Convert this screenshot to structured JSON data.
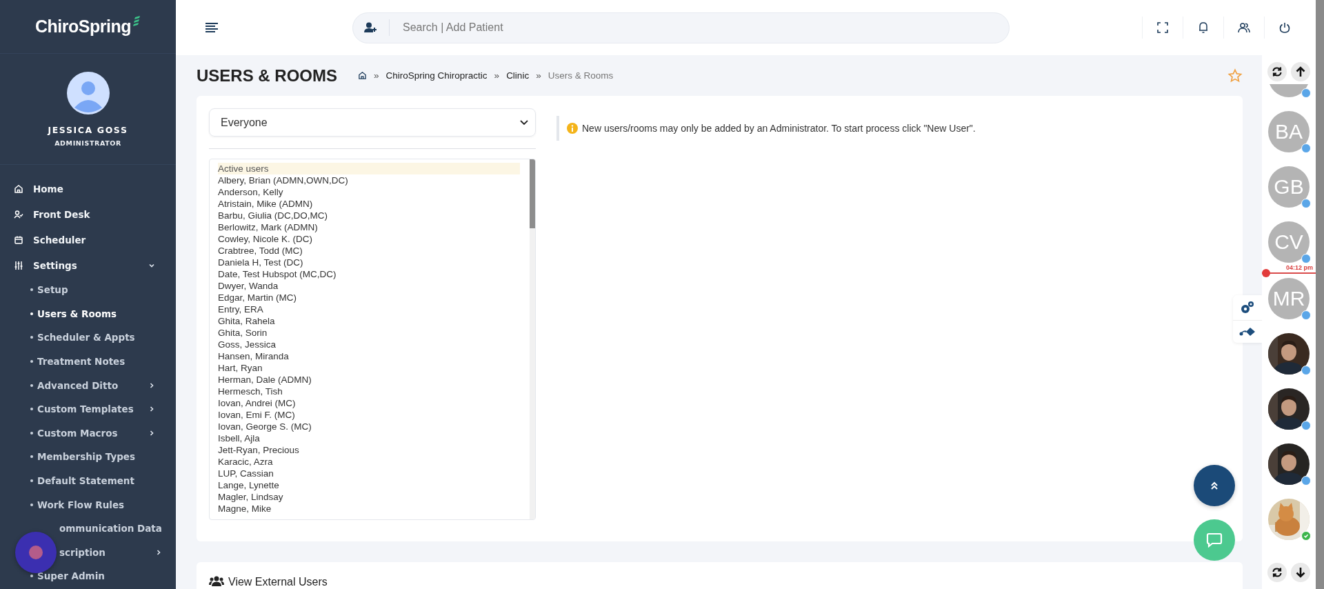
{
  "sidebar": {
    "logo": "ChiroSpring",
    "user": {
      "name": "JESSICA GOSS",
      "role": "ADMINISTRATOR"
    },
    "items": [
      {
        "label": "Home",
        "expanded": false,
        "has_submenu": false
      },
      {
        "label": "Front Desk",
        "expanded": false,
        "has_submenu": false
      },
      {
        "label": "Scheduler",
        "expanded": false,
        "has_submenu": false
      },
      {
        "label": "Settings",
        "expanded": true,
        "has_submenu": true,
        "children": [
          {
            "label": "Setup",
            "selected": false,
            "has_submenu": false,
            "covered": false
          },
          {
            "label": "Users & Rooms",
            "selected": true,
            "has_submenu": false,
            "covered": false
          },
          {
            "label": "Scheduler & Appts",
            "selected": false,
            "has_submenu": false,
            "covered": false
          },
          {
            "label": "Treatment Notes",
            "selected": false,
            "has_submenu": false,
            "covered": false
          },
          {
            "label": "Advanced Ditto",
            "selected": false,
            "has_submenu": true,
            "covered": false
          },
          {
            "label": "Custom Templates",
            "selected": false,
            "has_submenu": true,
            "covered": false
          },
          {
            "label": "Custom Macros",
            "selected": false,
            "has_submenu": true,
            "covered": false
          },
          {
            "label": "Membership Types",
            "selected": false,
            "has_submenu": false,
            "covered": false
          },
          {
            "label": "Default Statement",
            "selected": false,
            "has_submenu": false,
            "covered": false
          },
          {
            "label": "Work Flow Rules",
            "selected": false,
            "has_submenu": false,
            "covered": false
          },
          {
            "label": "ommunication Data",
            "selected": false,
            "has_submenu": false,
            "covered": true
          },
          {
            "label": "scription",
            "selected": false,
            "has_submenu": true,
            "covered": true
          },
          {
            "label": "Super Admin",
            "selected": false,
            "has_submenu": false,
            "covered": false
          }
        ]
      }
    ]
  },
  "topbar": {
    "search": {
      "placeholder": "Search | Add Patient"
    }
  },
  "page": {
    "title": "USERS & ROOMS",
    "breadcrumb": {
      "separator": "»",
      "items": [
        {
          "label": "ChiroSpring Chiropractic",
          "current": false
        },
        {
          "label": "Clinic",
          "current": false
        },
        {
          "label": "Users & Rooms",
          "current": true
        }
      ]
    },
    "favorite": false
  },
  "filter": {
    "value": "Everyone"
  },
  "users": [
    {
      "label": "Active users",
      "selected": true
    },
    {
      "label": "Albery, Brian (ADMN,OWN,DC)",
      "selected": false
    },
    {
      "label": "Anderson, Kelly",
      "selected": false
    },
    {
      "label": "Atristain, Mike (ADMN)",
      "selected": false
    },
    {
      "label": "Barbu, Giulia (DC,DO,MC)",
      "selected": false
    },
    {
      "label": "Berlowitz, Mark (ADMN)",
      "selected": false
    },
    {
      "label": "Cowley, Nicole K. (DC)",
      "selected": false
    },
    {
      "label": "Crabtree, Todd (MC)",
      "selected": false
    },
    {
      "label": "Daniela H, Test (DC)",
      "selected": false
    },
    {
      "label": "Date, Test Hubspot (MC,DC)",
      "selected": false
    },
    {
      "label": "Dwyer, Wanda",
      "selected": false
    },
    {
      "label": "Edgar, Martin (MC)",
      "selected": false
    },
    {
      "label": "Entry, ERA",
      "selected": false
    },
    {
      "label": "Ghita, Rahela",
      "selected": false
    },
    {
      "label": "Ghita, Sorin",
      "selected": false
    },
    {
      "label": "Goss, Jessica",
      "selected": false
    },
    {
      "label": "Hansen, Miranda",
      "selected": false
    },
    {
      "label": "Hart, Ryan",
      "selected": false
    },
    {
      "label": "Herman, Dale (ADMN)",
      "selected": false
    },
    {
      "label": "Hermesch, Tish",
      "selected": false
    },
    {
      "label": "Iovan, Andrei (MC)",
      "selected": false
    },
    {
      "label": "Iovan, Emi F. (MC)",
      "selected": false
    },
    {
      "label": "Iovan, George S. (MC)",
      "selected": false
    },
    {
      "label": "Isbell, Ajla",
      "selected": false
    },
    {
      "label": "Jett-Ryan, Precious",
      "selected": false
    },
    {
      "label": "Karacic, Azra",
      "selected": false
    },
    {
      "label": "LUP, Cassian",
      "selected": false
    },
    {
      "label": "Lange, Lynette",
      "selected": false
    },
    {
      "label": "Magler, Lindsay",
      "selected": false
    },
    {
      "label": "Magne, Mike",
      "selected": false
    }
  ],
  "notice": "New users/rooms may only be added by an Administrator. To start process click \"New User\".",
  "external": {
    "title": "View External Users"
  },
  "rail": {
    "items": [
      {
        "kind": "partial",
        "color": "#5aa6e8",
        "checked": false
      },
      {
        "kind": "initials",
        "initials": "BA",
        "color": "#5aa6e8",
        "checked": false
      },
      {
        "kind": "initials",
        "initials": "GB",
        "color": "#5aa6e8",
        "checked": false
      },
      {
        "kind": "initials",
        "initials": "CV",
        "color": "#5aa6e8",
        "checked": false
      },
      {
        "kind": "now",
        "time": "04:12 pm"
      },
      {
        "kind": "initials",
        "initials": "MR",
        "color": "#5aa6e8",
        "checked": false
      },
      {
        "kind": "picture",
        "color": "#5aa6e8",
        "checked": false
      },
      {
        "kind": "picture",
        "color": "#5aa6e8",
        "checked": false
      },
      {
        "kind": "picture",
        "color": "#5aa6e8",
        "checked": false
      },
      {
        "kind": "picture",
        "color": "#3cb54a",
        "checked": true
      }
    ]
  }
}
